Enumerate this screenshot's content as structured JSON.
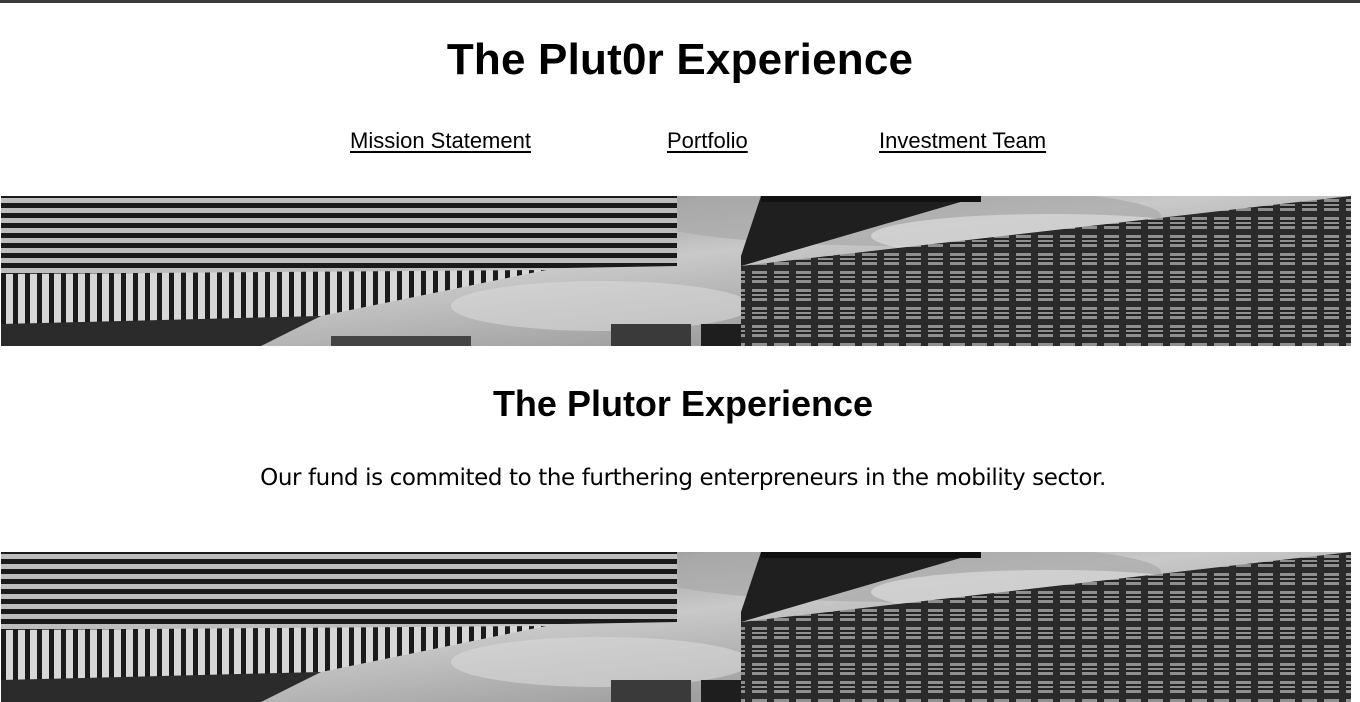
{
  "header": {
    "site_title": "The Plut0r Experience"
  },
  "nav": {
    "items": [
      {
        "label": "Mission Statement"
      },
      {
        "label": "Portfolio"
      },
      {
        "label": "Investment Team"
      }
    ]
  },
  "banner": {
    "description_icon": "skyscraper-banner-image",
    "palette": [
      "#0f0f0f",
      "#3d3d3d",
      "#8e8e8e",
      "#d0d0d0"
    ]
  },
  "main": {
    "section_title": "The Plutor Experience",
    "tagline": "Our fund is commited to the furthering enterpreneurs in the mobility sector."
  },
  "colors": {
    "text": "#000000",
    "background": "#ffffff",
    "top_border": "#3a3a3a"
  }
}
